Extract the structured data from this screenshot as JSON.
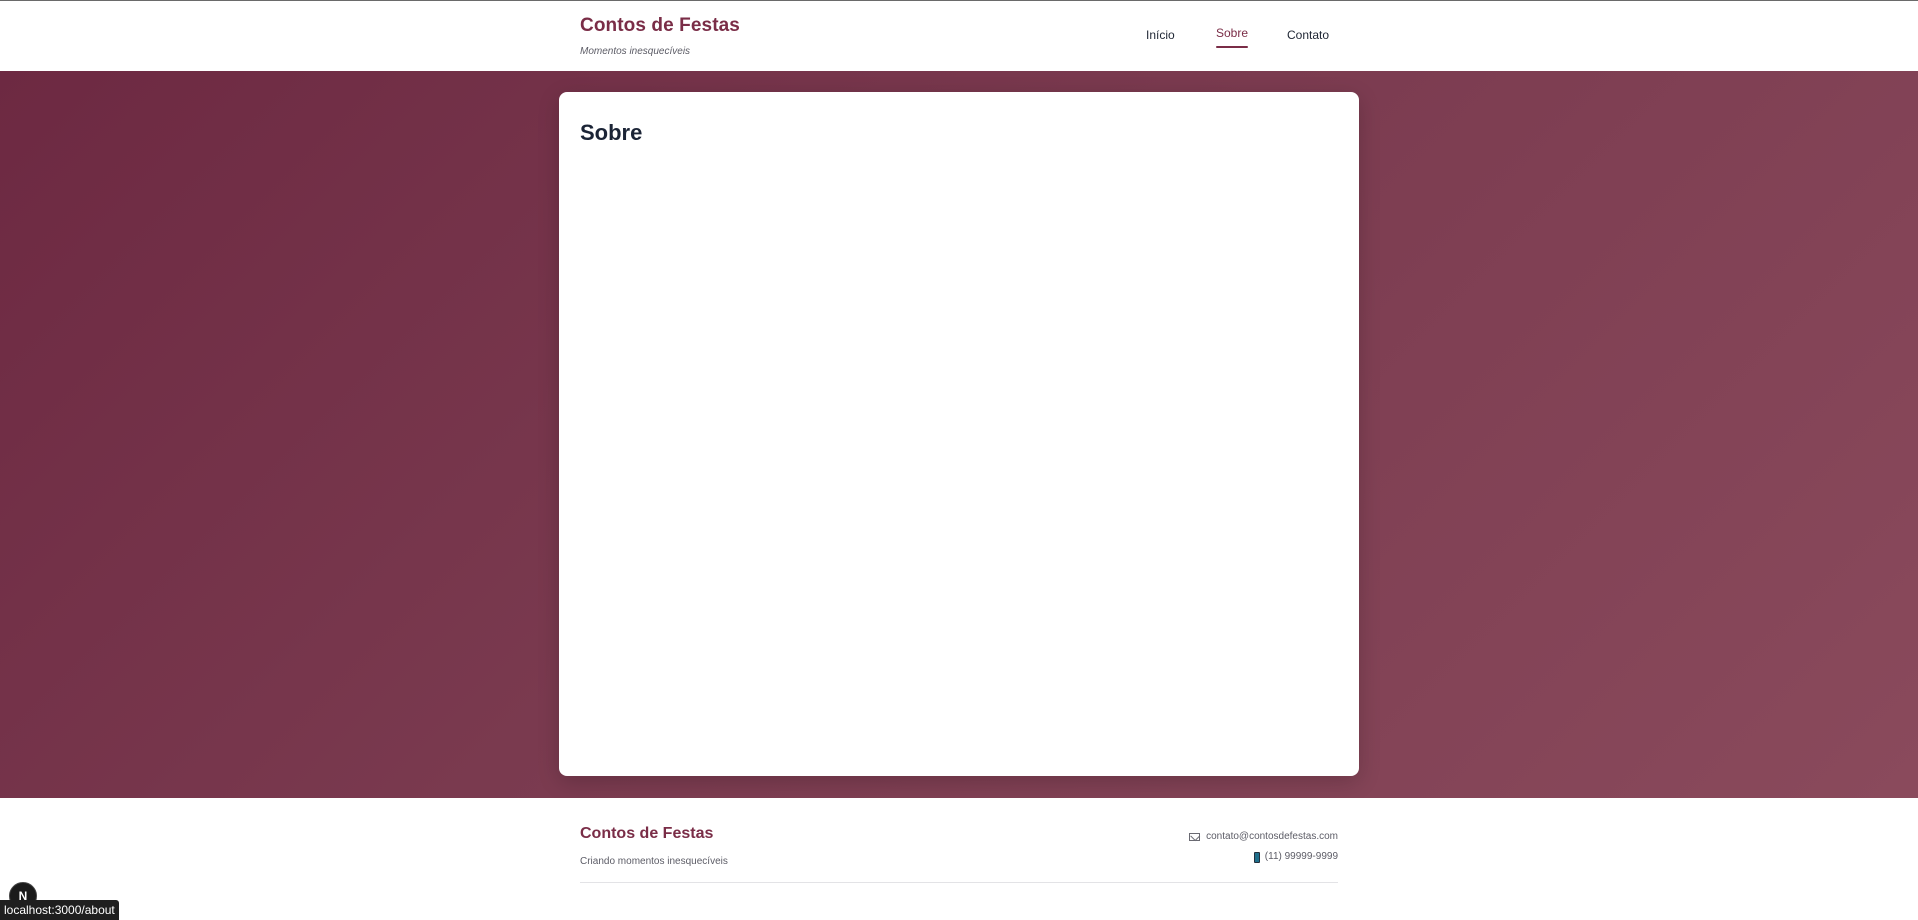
{
  "header": {
    "brand_title": "Contos de Festas",
    "brand_tagline": "Momentos inesquecíveis",
    "nav": [
      {
        "label": "Início",
        "active": false
      },
      {
        "label": "Sobre",
        "active": true
      },
      {
        "label": "Contato",
        "active": false
      }
    ]
  },
  "main": {
    "page_title": "Sobre"
  },
  "footer": {
    "brand_title": "Contos de Festas",
    "tagline": "Criando momentos inesquecíveis",
    "email": "contato@contosdefestas.com",
    "phone": "(11) 99999-9999",
    "email_icon": "envelope-icon",
    "phone_icon": "mobile-phone-icon"
  },
  "overlay": {
    "dev_badge_letter": "N",
    "status_url": "localhost:3000/about"
  },
  "colors": {
    "brand": "#7a2d47",
    "hero_bg_start": "#6d2942",
    "hero_bg_end": "#8a4a5c",
    "text_dark": "#1b2436"
  }
}
